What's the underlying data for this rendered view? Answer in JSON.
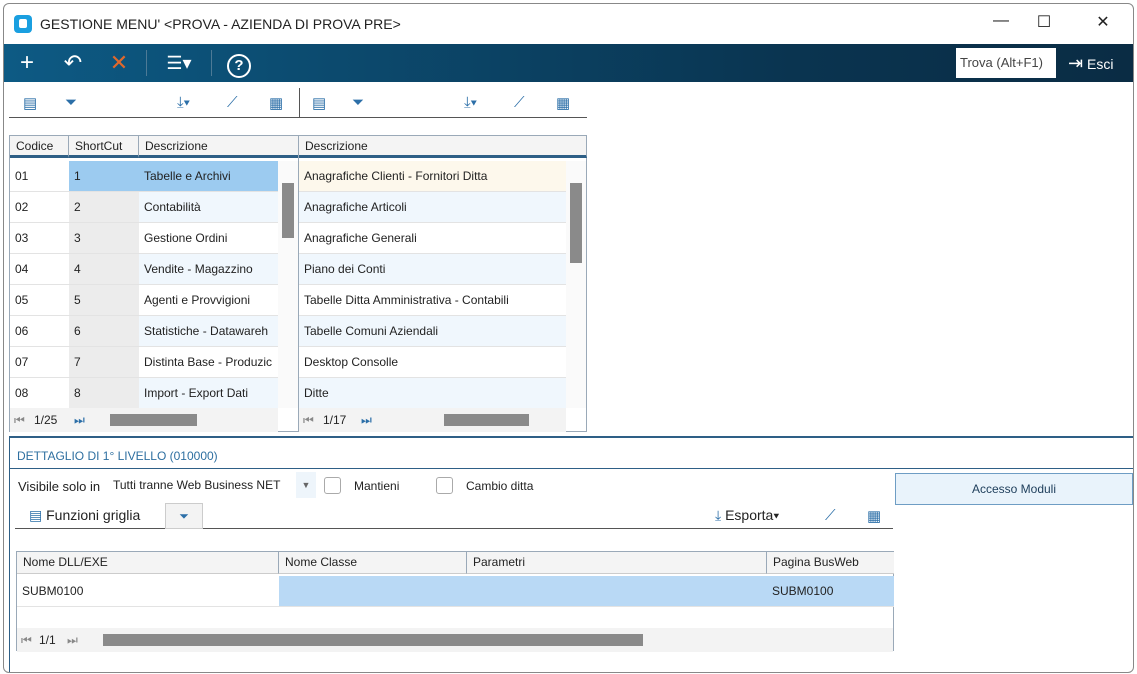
{
  "window": {
    "title": "GESTIONE MENU' <PROVA - AZIENDA DI PROVA PRE>",
    "minimize": "—",
    "maximize": "☐",
    "close": "✕"
  },
  "toolbar": {
    "add": "+",
    "undo": "↶",
    "delete": "✕",
    "menu": "☰▾",
    "help": "?",
    "search_placeholder": "Trova (Alt+F1)",
    "exit_label": "Esci"
  },
  "left_grid": {
    "headers": [
      "Codice",
      "ShortCut",
      "Descrizione"
    ],
    "rows": [
      [
        "01",
        "1",
        "Tabelle e Archivi"
      ],
      [
        "02",
        "2",
        "Contabilità"
      ],
      [
        "03",
        "3",
        "Gestione Ordini"
      ],
      [
        "04",
        "4",
        "Vendite - Magazzino"
      ],
      [
        "05",
        "5",
        "Agenti e Provvigioni"
      ],
      [
        "06",
        "6",
        "Statistiche - Datawareh"
      ],
      [
        "07",
        "7",
        "Distinta Base - Produzic"
      ],
      [
        "08",
        "8",
        "Import - Export Dati"
      ]
    ],
    "pager": "1/25"
  },
  "right_grid": {
    "headers": [
      "Descrizione"
    ],
    "rows": [
      "Anagrafiche Clienti - Fornitori Ditta",
      "Anagrafiche Articoli",
      "Anagrafiche Generali",
      "Piano dei Conti",
      "Tabelle Ditta Amministrativa - Contabili",
      "Tabelle Comuni Aziendali",
      "Desktop Consolle",
      "Ditte"
    ],
    "pager": "1/17"
  },
  "detail": {
    "title": "DETTAGLIO DI 1° LIVELLO (010000)",
    "visible_label": "Visibile solo in",
    "visible_value": "Tutti tranne Web Business NET",
    "mantieni": "Mantieni",
    "cambio_ditta": "Cambio ditta",
    "accesso_moduli": "Accesso Moduli",
    "funzioni_griglia": "Funzioni griglia",
    "esporta": "Esporta",
    "headers": [
      "Nome DLL/EXE",
      "Nome Classe",
      "Parametri",
      "Pagina BusWeb"
    ],
    "row": [
      "SUBM0100",
      "",
      "",
      "SUBM0100"
    ],
    "pager": "1/1"
  },
  "colors": {
    "accent": "#2e5f86",
    "selected": "#9ccbf0",
    "toolbar": "#0a3450"
  }
}
